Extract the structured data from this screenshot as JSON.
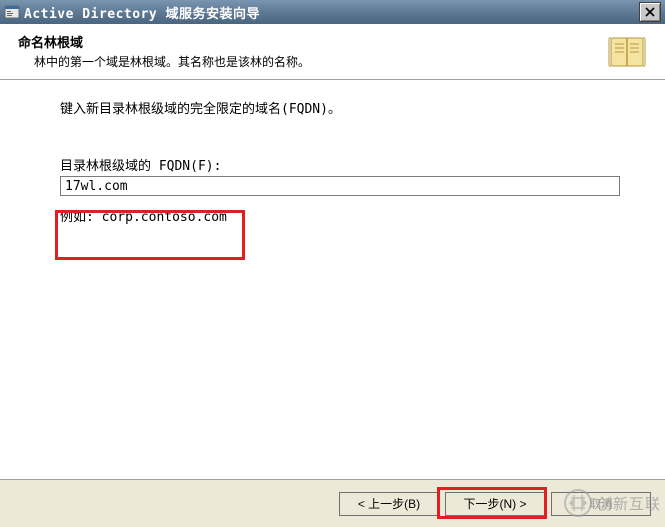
{
  "titlebar": {
    "title": "Active Directory 域服务安装向导"
  },
  "header": {
    "title": "命名林根域",
    "description": "林中的第一个域是林根域。其名称也是该林的名称。"
  },
  "body": {
    "instruction": "键入新目录林根级域的完全限定的域名(FQDN)。",
    "field_label": "目录林根级域的 FQDN(F):",
    "fqdn_value": "17wl.com",
    "example": "例如: corp.contoso.com"
  },
  "footer": {
    "back_label": "< 上一步(B)",
    "next_label": "下一步(N) >",
    "cancel_label": "取消"
  },
  "watermark": {
    "text": "创新互联"
  }
}
